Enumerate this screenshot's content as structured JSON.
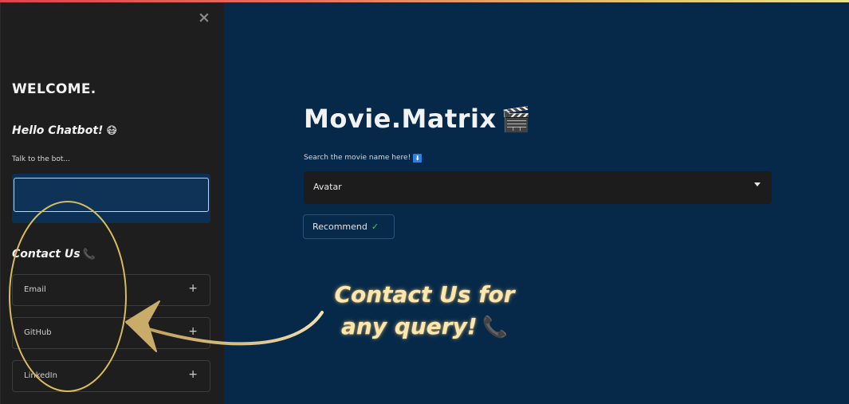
{
  "sidebar": {
    "close_label": "×",
    "welcome": "WELCOME.",
    "hello": "Hello Chatbot!",
    "hello_emoji": "😷",
    "talk_label": "Talk to the bot...",
    "chat_input_value": "",
    "contact_title": "Contact Us",
    "contact_emoji": "📞",
    "expanders": [
      {
        "label": "Email",
        "icon": "+"
      },
      {
        "label": "GitHub",
        "icon": "+"
      },
      {
        "label": "LinkedIn",
        "icon": "+"
      }
    ]
  },
  "main": {
    "title": "Movie.Matrix",
    "title_emoji": "🎬",
    "search_label": "Search the movie name here!",
    "search_emoji": "⬇",
    "selected_movie": "Avatar",
    "recommend_label": "Recommend",
    "recommend_icon": "✓"
  },
  "annotation": {
    "line1": "Contact Us for",
    "line2": "any query!",
    "emoji": "📞"
  },
  "colors": {
    "main_bg": "#06294a",
    "sidebar_bg": "#1e1e1e",
    "accent_gold": "#e0c15a",
    "check_green": "#3fcf4f"
  }
}
